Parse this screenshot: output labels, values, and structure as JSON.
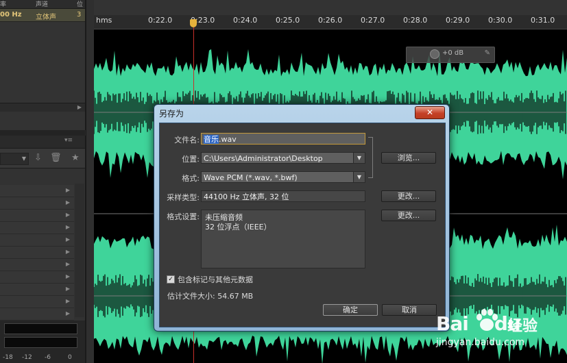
{
  "files_panel": {
    "header_cols": [
      "率",
      "声道",
      "位"
    ],
    "row": {
      "rate": "00 Hz",
      "channels": "立体声",
      "bit": "3"
    }
  },
  "meter": {
    "scale": [
      "-18",
      "-12",
      "-6",
      "0"
    ]
  },
  "editor": {
    "ruler_unit": "hms",
    "ruler_ticks": [
      "0:22.0",
      "0:23.0",
      "0:24.0",
      "0:25.0",
      "0:26.0",
      "0:27.0",
      "0:28.0",
      "0:29.0",
      "0:30.0",
      "0:31.0"
    ],
    "hud_gain": "+0 dB",
    "wave_color": "#3fd49a"
  },
  "dialog": {
    "title": "另存为",
    "close_glyph": "✕",
    "filename_label": "文件名:",
    "filename_selected": "音乐",
    "filename_ext": ".wav",
    "location_label": "位置:",
    "location_value": "C:\\Users\\Administrator\\Desktop",
    "browse_button": "浏览...",
    "format_label": "格式:",
    "format_value": "Wave PCM (*.wav, *.bwf)",
    "sample_type_label": "采样类型:",
    "sample_type_value": "44100 Hz 立体声, 32 位",
    "change_button": "更改...",
    "format_settings_label": "格式设置:",
    "format_settings_lines": [
      "未压缩音频",
      "32 位浮点（IEEE）"
    ],
    "format_change_button": "更改...",
    "include_markers_checked": true,
    "include_markers_label": "包含标记与其他元数据",
    "estimated_size": "估计文件大小: 54.67 MB",
    "ok_button": "确定",
    "cancel_button": "取消"
  },
  "watermark": {
    "brand": "Bai",
    "brand2": "du",
    "jingyan": "经验",
    "url": "jingyan.baidu.com"
  }
}
